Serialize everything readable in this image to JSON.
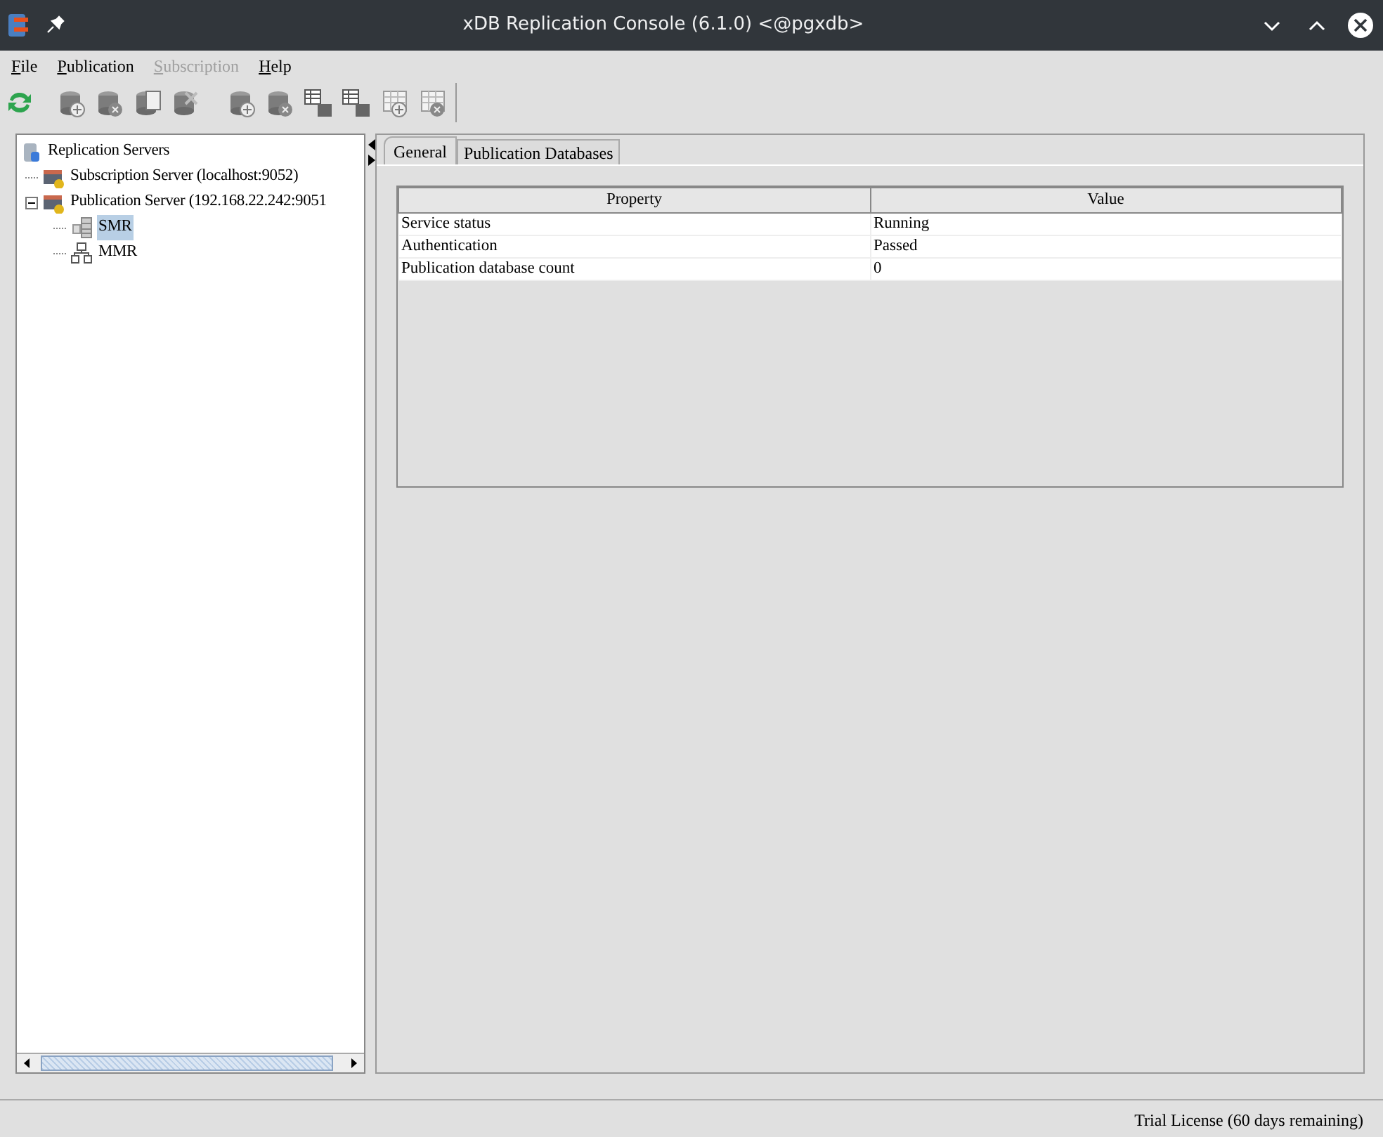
{
  "window": {
    "title": "xDB Replication Console (6.1.0) <@pgxdb>"
  },
  "menu": [
    {
      "label": "File",
      "disabled": false
    },
    {
      "label": "Publication",
      "disabled": false
    },
    {
      "label": "Subscription",
      "disabled": true
    },
    {
      "label": "Help",
      "disabled": false
    }
  ],
  "tree": [
    {
      "label": "Replication Servers",
      "kind": "root",
      "selected": false,
      "children": [
        {
          "label": "Subscription Server (localhost:9052)",
          "kind": "server",
          "selected": false
        },
        {
          "label": "Publication Server (192.168.22.242:9051",
          "kind": "server",
          "selected": false,
          "expanded": true,
          "children": [
            {
              "label": "SMR",
              "kind": "smr",
              "selected": true
            },
            {
              "label": "MMR",
              "kind": "mmr",
              "selected": false
            }
          ]
        }
      ]
    }
  ],
  "tabs": [
    {
      "label": "General",
      "selected": true
    },
    {
      "label": "Publication Databases",
      "selected": false
    }
  ],
  "table": {
    "columns": [
      "Property",
      "Value"
    ],
    "rows": [
      [
        "Service status",
        "Running"
      ],
      [
        "Authentication",
        "Passed"
      ],
      [
        "Publication database count",
        "0"
      ]
    ]
  },
  "status_bar": "Trial License (60 days remaining)"
}
